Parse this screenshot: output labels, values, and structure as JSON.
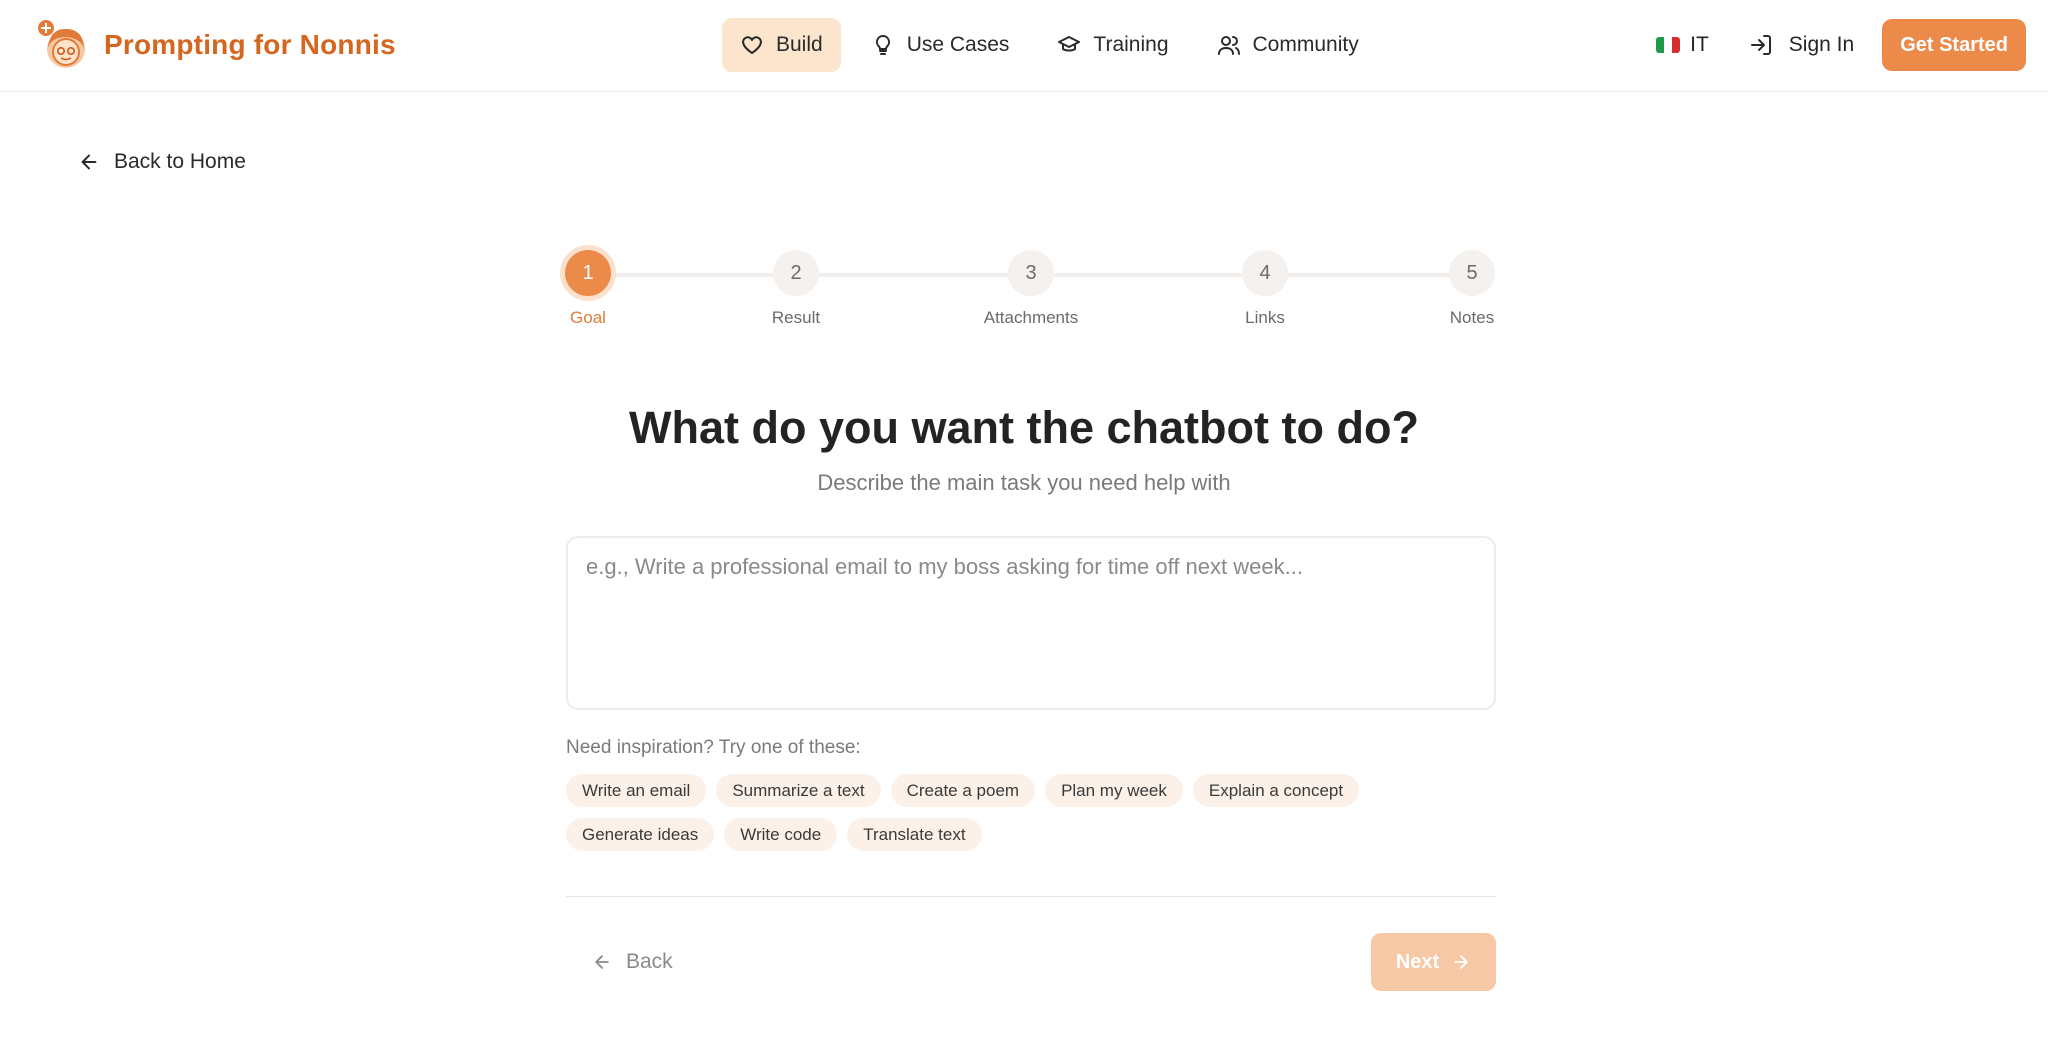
{
  "brand": {
    "name": "Prompting for Nonnis",
    "logo_icon": "grandma-avatar-icon",
    "accent": "#d4661f"
  },
  "nav": {
    "items": [
      {
        "label": "Build",
        "icon": "heart-icon",
        "active": true
      },
      {
        "label": "Use Cases",
        "icon": "lightbulb-icon",
        "active": false
      },
      {
        "label": "Training",
        "icon": "graduation-cap-icon",
        "active": false
      },
      {
        "label": "Community",
        "icon": "users-icon",
        "active": false
      }
    ]
  },
  "header_right": {
    "language": "IT",
    "sign_in": "Sign In",
    "get_started": "Get Started",
    "primary_color": "#ec8a49"
  },
  "back_home": "Back to Home",
  "stepper": {
    "current": 1,
    "steps": [
      {
        "number": "1",
        "label": "Goal"
      },
      {
        "number": "2",
        "label": "Result"
      },
      {
        "number": "3",
        "label": "Attachments"
      },
      {
        "number": "4",
        "label": "Links"
      },
      {
        "number": "5",
        "label": "Notes"
      }
    ]
  },
  "main": {
    "title": "What do you want the chatbot to do?",
    "subtitle": "Describe the main task you need help with",
    "goal_placeholder": "e.g., Write a professional email to my boss asking for time off next week...",
    "goal_value": "",
    "inspiration_label": "Need inspiration? Try one of these:",
    "suggestions": [
      "Write an email",
      "Summarize a text",
      "Create a poem",
      "Plan my week",
      "Explain a concept",
      "Generate ideas",
      "Write code",
      "Translate text"
    ]
  },
  "footer_nav": {
    "back": "Back",
    "next": "Next",
    "next_disabled": true
  }
}
